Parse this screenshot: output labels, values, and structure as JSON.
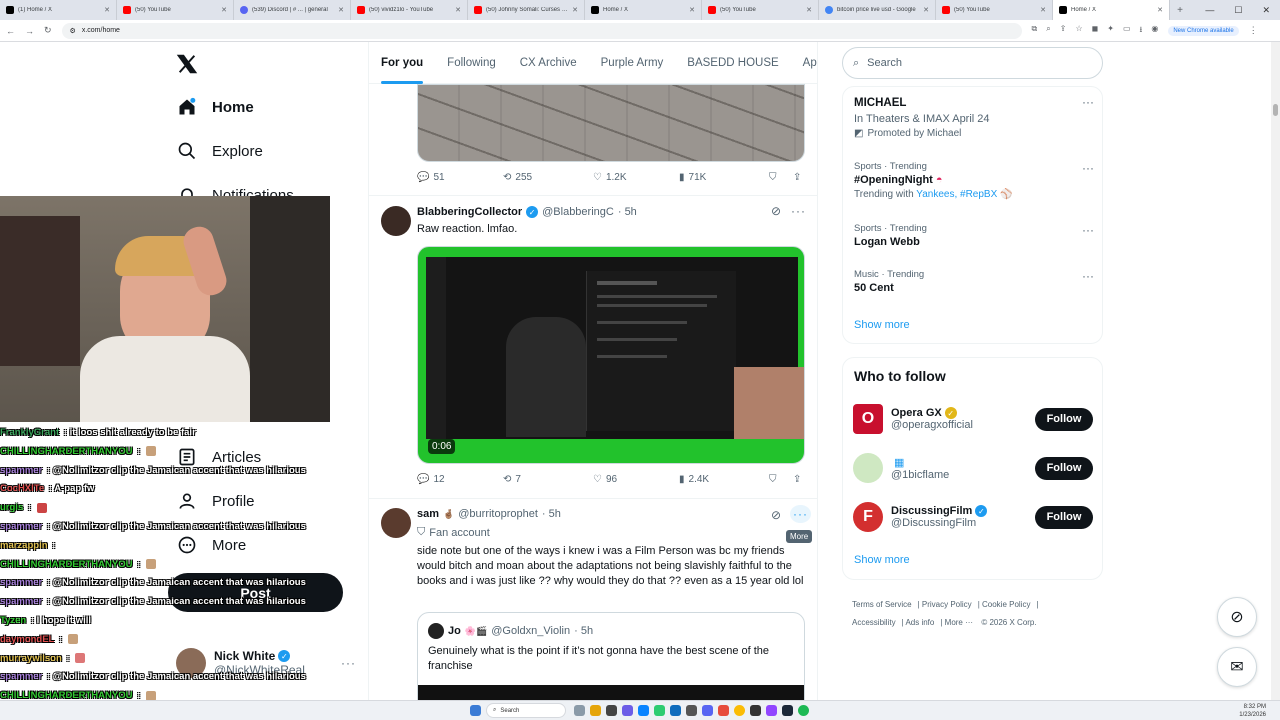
{
  "browser": {
    "tabs": [
      {
        "title": "(1) Home / X",
        "icon": "x"
      },
      {
        "title": "(50) YouTube",
        "icon": "yt"
      },
      {
        "title": "(539) Discord | # ... | general",
        "icon": "dc"
      },
      {
        "title": "(50) vividz1lo - YouTube",
        "icon": "yt"
      },
      {
        "title": "(50) Johnny Somali: Curses Ko...",
        "icon": "yt"
      },
      {
        "title": "Home / X",
        "icon": "x"
      },
      {
        "title": "(50) YouTube",
        "icon": "yt"
      },
      {
        "title": "bitcoin price live usd - Google",
        "icon": "g"
      },
      {
        "title": "(50) YouTube",
        "icon": "yt"
      },
      {
        "title": "Home / X",
        "icon": "x",
        "active": true
      }
    ],
    "url": "x.com/home",
    "new_chrome": "New Chrome available"
  },
  "nav": {
    "items": [
      {
        "label": "Home",
        "icon": "home-icon",
        "bold": true
      },
      {
        "label": "Explore",
        "icon": "search-icon"
      },
      {
        "label": "Notifications",
        "icon": "bell-icon"
      },
      {
        "label": "Articles",
        "icon": "articles-icon"
      },
      {
        "label": "Profile",
        "icon": "profile-icon"
      },
      {
        "label": "More",
        "icon": "more-circle-icon"
      }
    ],
    "post": "Post",
    "user": {
      "name": "Nick White",
      "handle": "@NickWhiteReal"
    }
  },
  "chat": [
    {
      "user": "FranklyGrant",
      "color": "#3aa55c",
      "msg": "it loos shit already to be fair",
      "emote": ""
    },
    {
      "user": "CHILLINGHARDERTHANYOU",
      "color": "#33cc33",
      "msg": "",
      "emote": "#c7a07a"
    },
    {
      "user": "spammer",
      "color": "#a77fdb",
      "msg": "@Nolimitzor clip the Jamaican accent that was hilarious",
      "emote": ""
    },
    {
      "user": "CocHXITe",
      "color": "#e05050",
      "msg": "A-pap fw",
      "emote": ""
    },
    {
      "user": "urgis",
      "color": "#33cc33",
      "msg": "",
      "emote": "#c44"
    },
    {
      "user": "spammer",
      "color": "#a77fdb",
      "msg": "@Nolimitzor clip the Jamaican accent that was hilarious",
      "emote": ""
    },
    {
      "user": "marzappin",
      "color": "#e0c050",
      "msg": "",
      "emote": "#fff"
    },
    {
      "user": "CHILLINGHARDERTHANYOU",
      "color": "#33cc33",
      "msg": "",
      "emote": "#c7a07a"
    },
    {
      "user": "spammer",
      "color": "#a77fdb",
      "msg": "@Nolimitzor clip the Jamaican accent that was hilarious",
      "emote": ""
    },
    {
      "user": "spammer",
      "color": "#a77fdb",
      "msg": "@Nolimitzor clip the Jamaican accent that was hilarious",
      "emote": ""
    },
    {
      "user": "Tyzen",
      "color": "#33cc33",
      "msg": "I hope it will",
      "emote": ""
    },
    {
      "user": "daymondEL",
      "color": "#e05050",
      "msg": "",
      "emote": "#c7a07a"
    },
    {
      "user": "murraywilson",
      "color": "#e0c050",
      "msg": "",
      "emote": "#d77"
    },
    {
      "user": "spammer",
      "color": "#a77fdb",
      "msg": "@Nolimitzor clip the Jamaican accent that was hilarious",
      "emote": ""
    },
    {
      "user": "CHILLINGHARDERTHANYOU",
      "color": "#33cc33",
      "msg": "",
      "emote": "#c7a07a"
    }
  ],
  "feed": {
    "tabs": [
      "For you",
      "Following",
      "CX Archive",
      "Purple Army",
      "BASEDD HOUSE",
      "Ape"
    ],
    "tweet0_stats": {
      "replies": "51",
      "reposts": "255",
      "likes": "1.2K",
      "views": "71K"
    },
    "tweet1": {
      "name": "BlabberingCollector",
      "handle": "@BlabberingC",
      "time": "· 5h",
      "text": "Raw reaction. lmfao.",
      "duration": "0:06",
      "stats": {
        "replies": "12",
        "reposts": "7",
        "likes": "96",
        "views": "2.4K"
      }
    },
    "tweet2": {
      "name": "sam",
      "handle": "@burritoprophet",
      "time": "· 5h",
      "label": "Fan account",
      "text": "side note but one of the ways i knew i was a Film Person was bc my friends would bitch and moan about the adaptations not being slavishly faithful to the books and i was just like ?? why would they do that ?? even as a 15 year old lol",
      "quote": {
        "name": "Jo",
        "handle": "@Goldxn_Violin",
        "time": "· 5h",
        "text": "Genuinely what is the point if it’s not gonna have the best scene of the franchise"
      }
    },
    "tooltip": "More"
  },
  "sidebar": {
    "search_placeholder": "Search",
    "promo": {
      "title": "MICHAEL",
      "sub": "In Theaters & IMAX April 24",
      "promoted": "Promoted by Michael"
    },
    "trends": [
      {
        "meta": "Sports · Trending",
        "title": "#OpeningNight",
        "with_label": "Trending with",
        "with": "Yankees, #RepBX"
      },
      {
        "meta": "Sports · Trending",
        "title": "Logan Webb"
      },
      {
        "meta": "Music · Trending",
        "title": "50 Cent"
      }
    ],
    "show_more": "Show more",
    "who_title": "Who to follow",
    "who": [
      {
        "name": "Opera GX",
        "handle": "@operagxofficial",
        "color": "#c8102e"
      },
      {
        "name": "",
        "handle": "@1bicflame",
        "color": "#cfe8c2"
      },
      {
        "name": "DiscussingFilm",
        "handle": "@DiscussingFilm",
        "color": "#d32f2f"
      }
    ],
    "follow_label": "Follow",
    "who_show_more": "Show more",
    "footer": [
      "Terms of Service",
      "Privacy Policy",
      "Cookie Policy",
      "Accessibility",
      "Ads info",
      "More ···",
      "© 2026 X Corp."
    ]
  },
  "taskbar": {
    "search": "Search",
    "time": "8:32 PM",
    "date": "1/23/2026"
  }
}
